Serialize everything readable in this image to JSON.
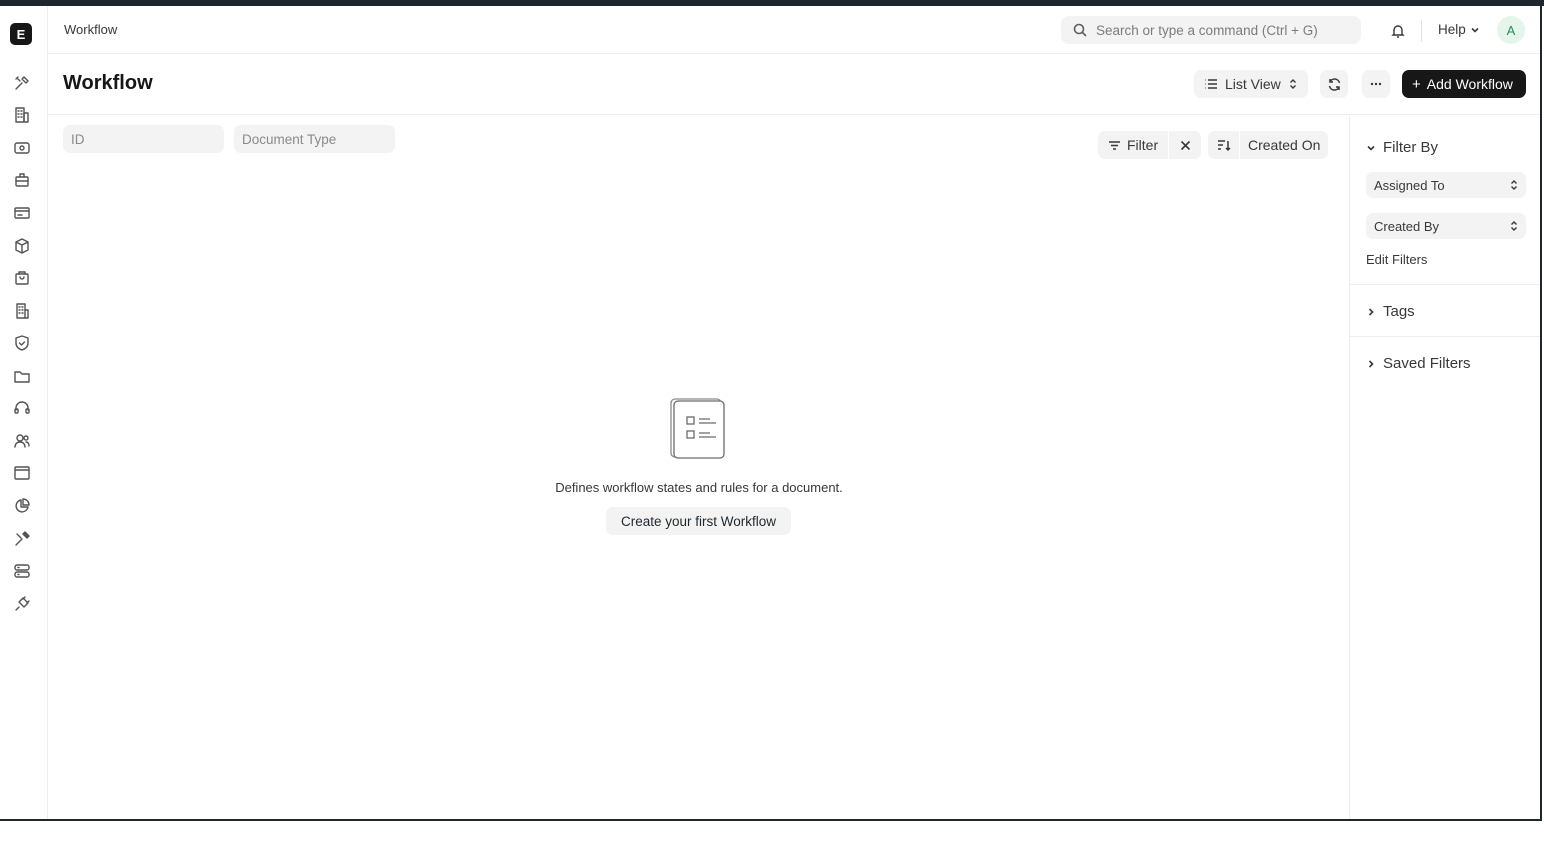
{
  "navbar": {
    "breadcrumb": "Workflow",
    "search_placeholder": "Search or type a command (Ctrl + G)",
    "help_label": "Help",
    "avatar_initial": "A"
  },
  "sidebar": {
    "logo_letter": "E",
    "icons": [
      "tools-icon",
      "building-icon",
      "accounting-icon",
      "briefcase-icon",
      "card-icon",
      "box-icon",
      "shopping-bag-icon",
      "organization-icon",
      "quality-badge-icon",
      "folder-icon",
      "headset-icon",
      "users-icon",
      "website-icon",
      "pie-chart-icon",
      "wrench-icon",
      "server-icon",
      "integrations-icon"
    ]
  },
  "page": {
    "title": "Workflow",
    "list_view_label": "List View",
    "add_button_label": "Add Workflow"
  },
  "filters": {
    "id_placeholder": "ID",
    "document_type_placeholder": "Document Type",
    "filter_label": "Filter",
    "sort_label": "Created On"
  },
  "empty_state": {
    "message": "Defines workflow states and rules for a document.",
    "create_label": "Create your first Workflow"
  },
  "right_panel": {
    "filter_by_label": "Filter By",
    "assigned_to_label": "Assigned To",
    "created_by_label": "Created By",
    "edit_filters_label": "Edit Filters",
    "tags_label": "Tags",
    "saved_filters_label": "Saved Filters"
  }
}
